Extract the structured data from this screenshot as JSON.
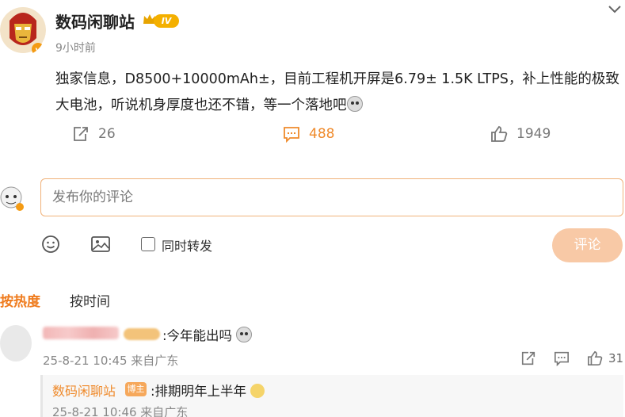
{
  "post": {
    "author": "数码闲聊站",
    "level": "IV",
    "time": "9小时前",
    "text": "独家信息，D8500+10000mAh±，目前工程机开屏是6.79± 1.5K LTPS，补上性能的极致大电池，听说机身厚度也还不错，等一个落地吧",
    "repost_count": "26",
    "comment_count": "488",
    "like_count": "1949"
  },
  "compose": {
    "placeholder": "发布你的评论",
    "repost_label": "同时转发",
    "submit_label": "评论"
  },
  "tabs": {
    "hot": "按热度",
    "time": "按时间"
  },
  "comments": [
    {
      "text": ":今年能出吗",
      "date": "25-8-21 10:45 来自广东",
      "likes": "31",
      "reply": {
        "author": "数码闲聊站",
        "badge": "博主",
        "text": ":排期明年上半年",
        "date": "25-8-21 10:46 来自广东"
      }
    }
  ],
  "colors": {
    "accent": "#ef7b1d",
    "button": "#f8c9a6"
  },
  "icons": [
    "chevron-down-icon",
    "repost-icon",
    "comment-icon",
    "like-icon",
    "emoji-icon",
    "image-icon",
    "crown-icon"
  ]
}
